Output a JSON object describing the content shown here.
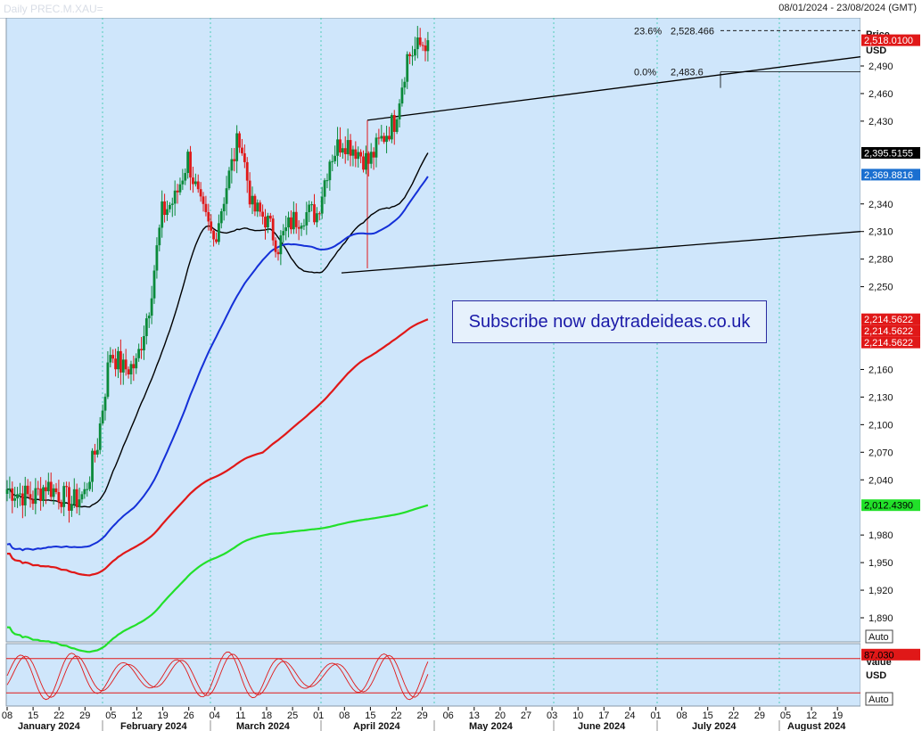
{
  "header": {
    "instrument": "Daily PREC.M.XAU=",
    "date_range": "08/01/2024 - 23/08/2024 (GMT)"
  },
  "banner": {
    "text": "Subscribe now daytradeideas.co.uk"
  },
  "colors": {
    "background": "#cfe6fb",
    "up_candle": "#0a8a3a",
    "down_candle": "#e01818",
    "ma_black": "#000000",
    "ma_blue": "#1430d8",
    "ma_red": "#e01818",
    "ma_green": "#22e02a"
  },
  "price_axis": {
    "ticks": [
      "2,490",
      "2,460",
      "2,430",
      "2,340",
      "2,310",
      "2,280",
      "2,250",
      "2,160",
      "2,130",
      "2,100",
      "2,070",
      "2,040",
      "1,980",
      "1,950",
      "1,920",
      "1,890"
    ],
    "label_price": "Price",
    "label_usd": "USD",
    "auto": "Auto"
  },
  "tags": [
    {
      "text": "2,518.0100",
      "bg": "#e01818",
      "fg": "#ffffff",
      "value": 2518.01
    },
    {
      "text": "2,395.5155",
      "bg": "#000000",
      "fg": "#ffffff",
      "value": 2395.5155
    },
    {
      "text": "2,369.8816",
      "bg": "#1a6fd0",
      "fg": "#ffffff",
      "value": 2369.8816
    },
    {
      "text": "2,214.5622",
      "bg": "#e01818",
      "fg": "#ffffff",
      "value": 2214.5622
    },
    {
      "text": "2,214.5622",
      "bg": "#e01818",
      "fg": "#ffffff",
      "value": 2214.5622
    },
    {
      "text": "2,214.5622",
      "bg": "#e01818",
      "fg": "#ffffff",
      "value": 2214.5622
    },
    {
      "text": "2,012.4390",
      "bg": "#22e02a",
      "fg": "#000000",
      "value": 2012.439
    }
  ],
  "fib": [
    {
      "pct": "23.6%",
      "value": "2,528.466"
    },
    {
      "pct": "0.0%",
      "value": "2,483.6"
    }
  ],
  "oscillator": {
    "value_tag": "87.030",
    "label_value": "Value",
    "label_usd": "USD",
    "auto": "Auto",
    "upper_level": 80,
    "lower_level": 20
  },
  "x_axis": {
    "days": [
      "08",
      "15",
      "22",
      "29",
      "05",
      "12",
      "19",
      "26",
      "04",
      "11",
      "18",
      "25",
      "01",
      "08",
      "15",
      "22",
      "29",
      "06",
      "13",
      "20",
      "27",
      "03",
      "10",
      "17",
      "24",
      "01",
      "08",
      "15",
      "22",
      "29",
      "05",
      "12",
      "19"
    ],
    "months": [
      "January 2024",
      "February 2024",
      "March 2024",
      "April 2024",
      "May 2024",
      "June 2024",
      "July 2024",
      "August 2024"
    ]
  },
  "chart_data": {
    "type": "candlestick",
    "period": "Daily",
    "date_range": [
      "2024-01-08",
      "2024-08-23"
    ],
    "ylim": [
      1870,
      2535
    ],
    "weekly_close_approx": [
      {
        "week": "2024-01-08",
        "close": 2030
      },
      {
        "week": "2024-01-15",
        "close": 2025
      },
      {
        "week": "2024-01-22",
        "close": 2020
      },
      {
        "week": "2024-01-29",
        "close": 2035
      },
      {
        "week": "2024-02-05",
        "close": 2025
      },
      {
        "week": "2024-02-12",
        "close": 2015
      },
      {
        "week": "2024-02-19",
        "close": 2025
      },
      {
        "week": "2024-02-26",
        "close": 2080
      },
      {
        "week": "2024-03-04",
        "close": 2180
      },
      {
        "week": "2024-03-11",
        "close": 2160
      },
      {
        "week": "2024-03-18",
        "close": 2165
      },
      {
        "week": "2024-03-25",
        "close": 2230
      },
      {
        "week": "2024-04-01",
        "close": 2330
      },
      {
        "week": "2024-04-08",
        "close": 2345
      },
      {
        "week": "2024-04-15",
        "close": 2390
      },
      {
        "week": "2024-04-22",
        "close": 2335
      },
      {
        "week": "2024-04-29",
        "close": 2300
      },
      {
        "week": "2024-05-06",
        "close": 2360
      },
      {
        "week": "2024-05-13",
        "close": 2415
      },
      {
        "week": "2024-05-20",
        "close": 2335
      },
      {
        "week": "2024-05-27",
        "close": 2325
      },
      {
        "week": "2024-06-03",
        "close": 2295
      },
      {
        "week": "2024-06-10",
        "close": 2320
      },
      {
        "week": "2024-06-17",
        "close": 2330
      },
      {
        "week": "2024-06-24",
        "close": 2330
      },
      {
        "week": "2024-07-01",
        "close": 2390
      },
      {
        "week": "2024-07-08",
        "close": 2410
      },
      {
        "week": "2024-07-15",
        "close": 2400
      },
      {
        "week": "2024-07-22",
        "close": 2385
      },
      {
        "week": "2024-07-29",
        "close": 2410
      },
      {
        "week": "2024-08-05",
        "close": 2430
      },
      {
        "week": "2024-08-12",
        "close": 2500
      },
      {
        "week": "2024-08-19",
        "close": 2512
      }
    ],
    "moving_averages": [
      {
        "color": "black",
        "last": 2395.5155
      },
      {
        "color": "blue",
        "last": 2369.8816
      },
      {
        "color": "red",
        "last": 2214.5622
      },
      {
        "color": "green",
        "last": 2012.439
      }
    ],
    "channel": {
      "upper": [
        {
          "date": "2024-04-12",
          "value": 2431
        },
        {
          "date": "2024-08-23",
          "value": 2500
        }
      ],
      "lower": [
        {
          "date": "2024-04-05",
          "value": 2265
        },
        {
          "date": "2024-08-23",
          "value": 2310
        }
      ]
    },
    "fibonacci": [
      {
        "level": "23.6%",
        "value": 2528.466
      },
      {
        "level": "0.0%",
        "value": 2483.6
      }
    ],
    "last_price": 2518.01,
    "stochastic_last": 87.03
  }
}
